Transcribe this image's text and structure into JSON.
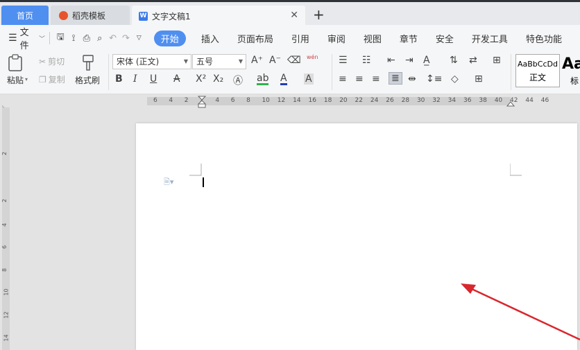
{
  "tabs": {
    "home": "首页",
    "templates": "稻壳模板",
    "document": "文字文稿1"
  },
  "menu": {
    "file": "文件",
    "items": [
      "开始",
      "插入",
      "页面布局",
      "引用",
      "审阅",
      "视图",
      "章节",
      "安全",
      "开发工具",
      "特色功能"
    ]
  },
  "ribbon": {
    "paste": "粘贴",
    "cut": "剪切",
    "copy": "复制",
    "format_painter": "格式刷",
    "font_name": "宋体 (正文)",
    "font_size": "五号",
    "phonetic": "wén",
    "style_sample": "AaBbCcDd",
    "style_normal": "正文",
    "style_heading_sample": "Aa",
    "style_heading_name": "标"
  },
  "ruler": {
    "h_labels": [
      "6",
      "4",
      "2",
      "2",
      "4",
      "6",
      "8",
      "10",
      "12",
      "14",
      "16",
      "18",
      "20",
      "22",
      "24",
      "26",
      "28",
      "30",
      "32",
      "34",
      "36",
      "38",
      "40",
      "42",
      "44",
      "46"
    ],
    "v_labels": [
      "2",
      "2",
      "4",
      "6",
      "8",
      "10",
      "12",
      "14"
    ]
  },
  "colors": {
    "accent": "#4f8ff0",
    "arrow": "#d9272e"
  }
}
